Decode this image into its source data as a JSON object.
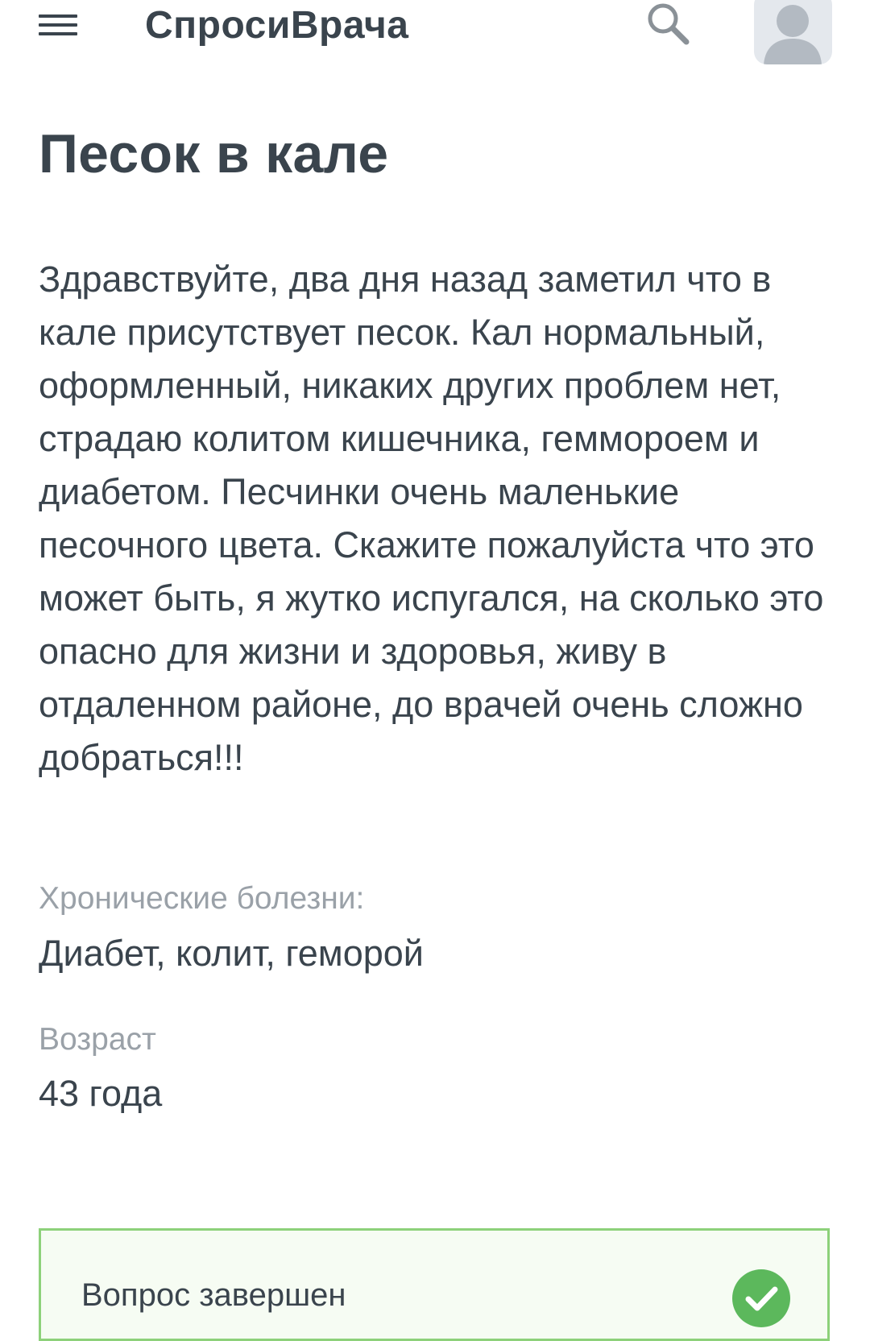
{
  "header": {
    "logo": "СпросиВрача",
    "menu_icon": "hamburger-menu-icon",
    "search_icon": "search-icon",
    "avatar_icon": "user-avatar-icon"
  },
  "question": {
    "title": "Песок в кале",
    "body": "Здравствуйте, два дня назад заметил что в кале присутствует песок. Кал нормальный, оформленный, никаких других проблем нет, страдаю колитом кишечника, геммороем и диабетом. Песчинки очень маленькие песочного цвета. Скажите пожалуйста что это может быть, я жутко испугался, на сколько это опасно для жизни и здоровья, живу в отдаленном районе, до врачей очень сложно добраться!!!"
  },
  "details": {
    "chronic_label": "Хронические болезни:",
    "chronic_value": "Диабет, колит, геморой",
    "age_label": "Возраст",
    "age_value": "43 года"
  },
  "status": {
    "text": "Вопрос завершен",
    "icon": "checkmark-icon"
  },
  "colors": {
    "text": "#3a444d",
    "muted": "#9aa1a8",
    "accent_green": "#5cb85c",
    "status_border": "#8dd17a",
    "status_bg": "#f6fcf3"
  }
}
